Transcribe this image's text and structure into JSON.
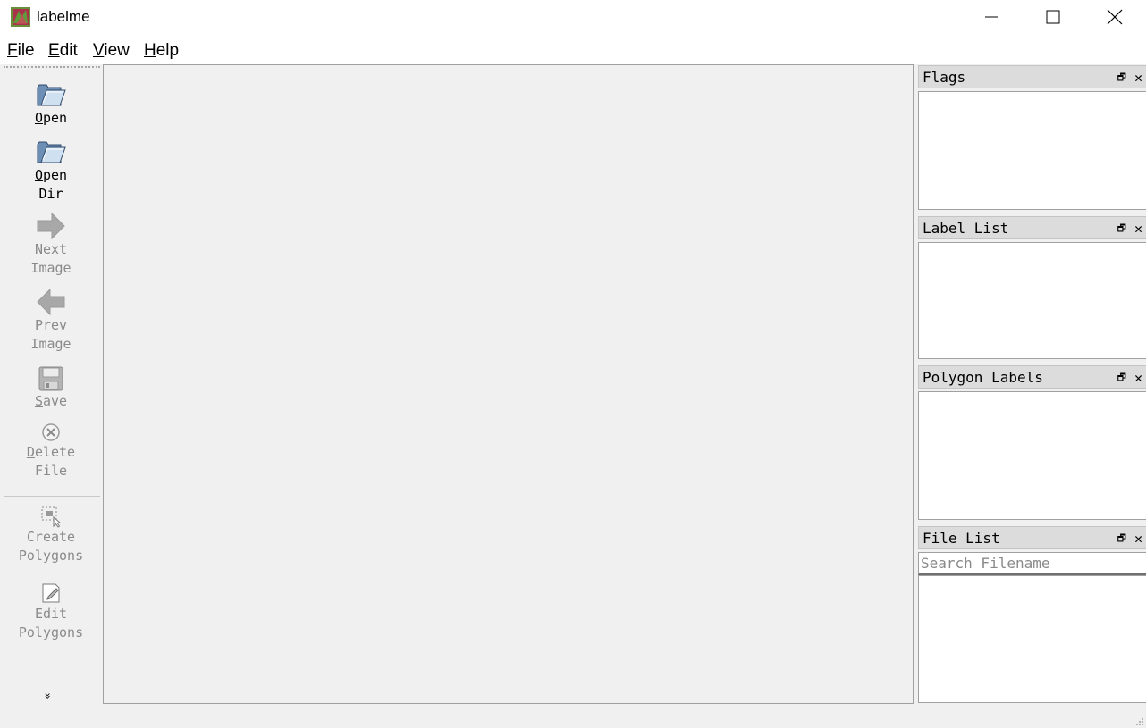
{
  "window": {
    "title": "labelme",
    "icon": "labelme-app-icon",
    "controls": [
      "minimize-icon",
      "maximize-icon",
      "close-icon"
    ]
  },
  "menubar": {
    "items": [
      {
        "mnemonic": "F",
        "rest": "ile"
      },
      {
        "mnemonic": "E",
        "rest": "dit"
      },
      {
        "mnemonic": "V",
        "rest": "iew"
      },
      {
        "mnemonic": "H",
        "rest": "elp"
      }
    ]
  },
  "toolbar": {
    "open": {
      "mnemonic": "O",
      "rest": "pen",
      "icon": "folder-open-icon",
      "enabled": true
    },
    "open_dir": {
      "mnemonic": "O",
      "rest": "pen",
      "line2": "Dir",
      "icon": "folder-open-icon",
      "enabled": true
    },
    "next_image": {
      "mnemonic": "N",
      "rest": "ext",
      "line2": "Image",
      "icon": "arrow-right-icon",
      "enabled": false
    },
    "prev_image": {
      "mnemonic": "P",
      "rest": "rev",
      "line2": "Image",
      "icon": "arrow-left-icon",
      "enabled": false
    },
    "save": {
      "mnemonic": "S",
      "rest": "ave",
      "icon": "floppy-disk-icon",
      "enabled": false
    },
    "delete_file": {
      "mnemonic": "D",
      "rest": "elete",
      "line2": "File",
      "icon": "delete-circle-icon",
      "enabled": false
    },
    "create_polygons": {
      "line1": "Create",
      "line2": "Polygons",
      "icon": "create-polygon-icon",
      "enabled": false
    },
    "edit_polygons": {
      "line1": "Edit",
      "line2": "Polygons",
      "icon": "edit-polygon-icon",
      "enabled": false
    },
    "extension": "»"
  },
  "docks": {
    "flags": {
      "title": "Flags"
    },
    "label_list": {
      "title": "Label List"
    },
    "polygon_labels": {
      "title": "Polygon Labels"
    },
    "file_list": {
      "title": "File List",
      "search_placeholder": "Search Filename"
    }
  },
  "colors": {
    "chrome": "#f0f0f0",
    "dock_title": "#dcdcdc",
    "panel": "#ffffff",
    "disabled_text": "#8a8a8a"
  }
}
